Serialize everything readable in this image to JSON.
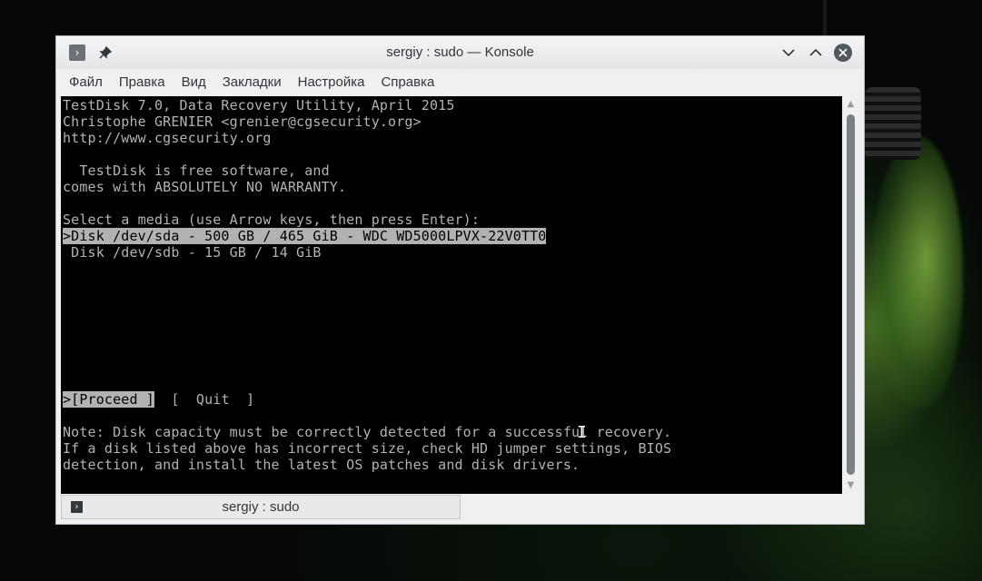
{
  "window": {
    "title": "sergiy : sudo — Konsole"
  },
  "menu": {
    "items": [
      "Файл",
      "Правка",
      "Вид",
      "Закладки",
      "Настройка",
      "Справка"
    ]
  },
  "terminal": {
    "lines": [
      "TestDisk 7.0, Data Recovery Utility, April 2015",
      "Christophe GRENIER <grenier@cgsecurity.org>",
      "http://www.cgsecurity.org",
      "",
      "  TestDisk is free software, and",
      "comes with ABSOLUTELY NO WARRANTY.",
      "",
      "Select a media (use Arrow keys, then press Enter):",
      ">Disk /dev/sda - 500 GB / 465 GiB - WDC WD5000LPVX-22V0TT0",
      " Disk /dev/sdb - 15 GB / 14 GiB"
    ],
    "actions": {
      "proceed": ">[Proceed ]",
      "quit": "[  Quit  ]"
    },
    "notes": [
      "Note: Disk capacity must be correctly detected for a successful recovery.",
      "If a disk listed above has incorrect size, check HD jumper settings, BIOS",
      "detection, and install the latest OS patches and disk drivers."
    ]
  },
  "tab": {
    "label": "sergiy : sudo"
  },
  "icons": {
    "app": "konsole-prompt-icon",
    "pin": "pin-icon",
    "minimize": "chevron-down-icon",
    "maximize": "chevron-up-icon",
    "close": "close-icon"
  },
  "colors": {
    "terminal_bg": "#000000",
    "terminal_fg": "#b2b2b2",
    "window_bg": "#eff0f1"
  }
}
